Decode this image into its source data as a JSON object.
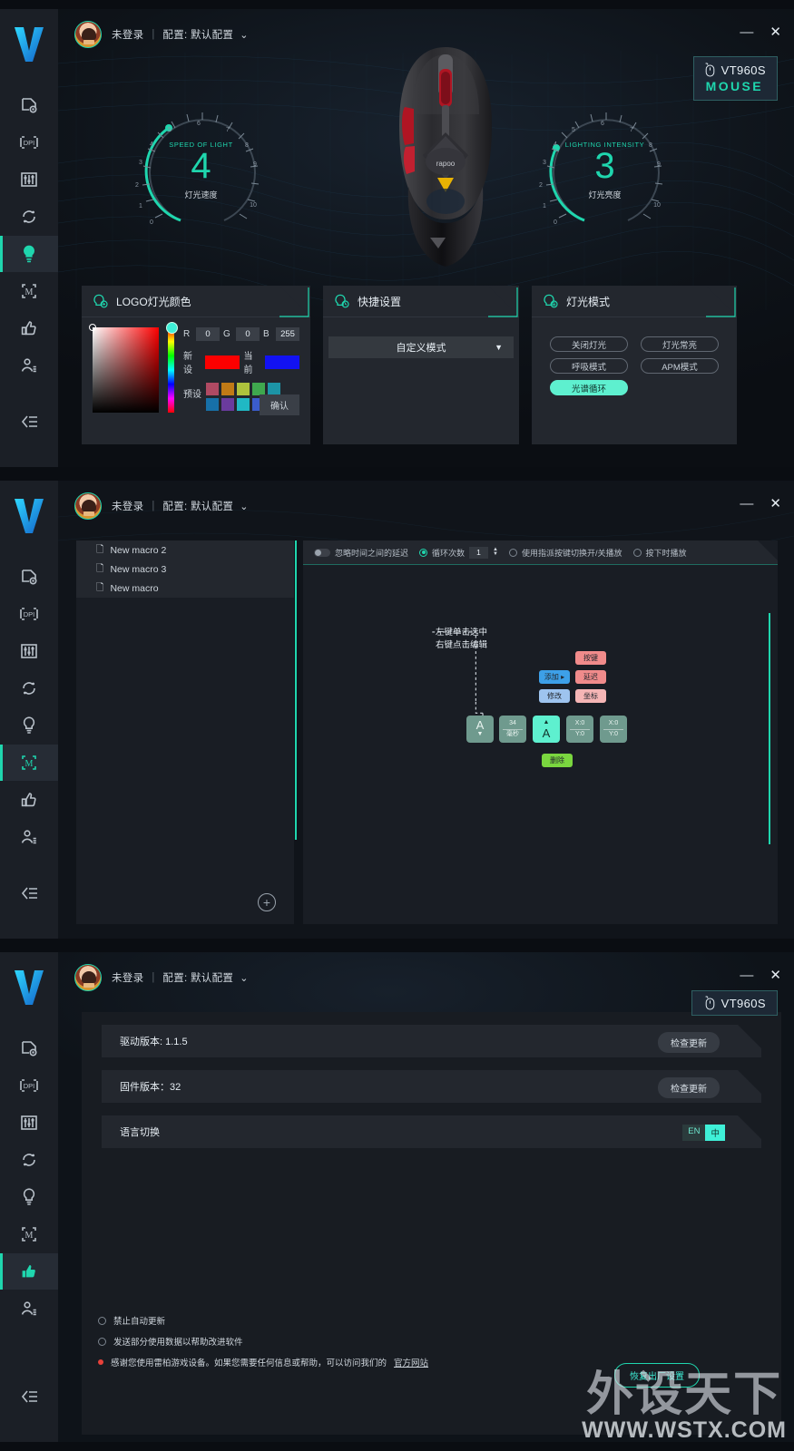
{
  "app": {
    "sidebar": {
      "logo": "rapoo-v-logo",
      "items": [
        {
          "name": "mouse-settings",
          "icon": "mouse-config-icon"
        },
        {
          "name": "dpi",
          "icon": "dpi-icon"
        },
        {
          "name": "performance",
          "icon": "sliders-icon"
        },
        {
          "name": "polling-rate",
          "icon": "refresh-icon"
        },
        {
          "name": "lighting",
          "icon": "lightbulb-icon"
        },
        {
          "name": "macro",
          "icon": "macro-m-icon"
        },
        {
          "name": "support",
          "icon": "thumbs-up-icon"
        },
        {
          "name": "profile",
          "icon": "user-icon"
        },
        {
          "name": "collapse",
          "icon": "collapse-icon"
        }
      ]
    },
    "topbar": {
      "user": "未登录",
      "separator": "|",
      "profile_label": "配置: 默认配置",
      "chevron": "⌄",
      "minimize": "—",
      "close": "✕"
    },
    "device": {
      "name": "VT960S",
      "type": "MOUSE",
      "icon": "mouse-pointer-icon"
    }
  },
  "lighting_window": {
    "dials": [
      {
        "name": "speed-of-light",
        "label": "SPEED OF LIGHT",
        "value": "4",
        "sub": "灯光速度",
        "min": "0",
        "max": "10",
        "ticks": [
          "0",
          "1",
          "2",
          "3",
          "4",
          "5",
          "6",
          "7",
          "8",
          "9",
          "10"
        ]
      },
      {
        "name": "lighting-intensity",
        "label": "LIGHTING INTENSITY",
        "value": "3",
        "sub": "灯光亮度",
        "min": "0",
        "max": "10",
        "ticks": [
          "0",
          "1",
          "2",
          "3",
          "4",
          "5",
          "6",
          "7",
          "8",
          "9",
          "10"
        ]
      }
    ],
    "color_panel": {
      "title": "LOGO灯光颜色",
      "icon": "bulb-color-icon",
      "r_label": "R",
      "r_value": "0",
      "g_label": "G",
      "g_value": "0",
      "b_label": "B",
      "b_value": "255",
      "new_label": "新设",
      "new_color": "#fc0000",
      "current_label": "当前",
      "current_color": "#1212f2",
      "preset_label": "预设",
      "presets": [
        "#b04a63",
        "#c07a16",
        "#aec23c",
        "#3fa84e",
        "#1c94a6",
        "#1770a8",
        "#6a3b9e",
        "#20b8c4",
        "#3b5ccc",
        "#b43cd2"
      ],
      "confirm_label": "确认"
    },
    "quick_panel": {
      "title": "快捷设置",
      "icon": "bulb-quick-icon",
      "selected": "自定义模式",
      "caret": "▼"
    },
    "mode_panel": {
      "title": "灯光模式",
      "icon": "bulb-mode-icon",
      "buttons": [
        {
          "label": "关闭灯光",
          "active": false
        },
        {
          "label": "灯光常亮",
          "active": false
        },
        {
          "label": "呼吸模式",
          "active": false
        },
        {
          "label": "APM模式",
          "active": false
        },
        {
          "label": "光谱循环",
          "active": true
        }
      ]
    }
  },
  "macro_window": {
    "list": [
      {
        "label": "New macro 2",
        "selected": true
      },
      {
        "label": "New macro 3",
        "selected": true
      },
      {
        "label": "New macro",
        "selected": true
      }
    ],
    "add_button": "+",
    "toolbar": {
      "ignore_delay": "忽略时间之间的延迟",
      "loop_count": "循环次数",
      "loop_value": "1",
      "toggle_play": "使用指派按键切换开/关播放",
      "play_on_press": "按下时播放"
    },
    "hint_line1": "左键单击选中",
    "hint_line2": "右键点击编辑",
    "menu": [
      {
        "label": "添加 ▸",
        "color": "#3da0e8",
        "name": "add-menu-item"
      },
      {
        "label": "修改",
        "color": "#9ec4ef",
        "name": "edit-menu-item"
      },
      {
        "label": "按键",
        "color": "#f08b8b",
        "name": "key-menu-item"
      },
      {
        "label": "延迟",
        "color": "#f08b8b",
        "name": "delay-menu-item"
      },
      {
        "label": "坐标",
        "color": "#f5b5b5",
        "name": "coord-menu-item"
      },
      {
        "label": "删除",
        "color": "#7ad63f",
        "name": "delete-menu-item"
      }
    ],
    "tiles": [
      {
        "name": "key-down-tile",
        "big": "A",
        "arrow": "▼",
        "color": "#6f9a8e",
        "selected": false
      },
      {
        "name": "delay-tile",
        "top": "34",
        "bottom": "毫秒",
        "color": "#6f9a8e",
        "selected": false
      },
      {
        "name": "key-up-tile",
        "big": "A",
        "arrow": "▲",
        "color": "#5ef0cf",
        "selected": true
      },
      {
        "name": "coord-tile-1",
        "top": "X:0",
        "bottom": "Y:0",
        "color": "#6f9a8e",
        "selected": false
      },
      {
        "name": "coord-tile-2",
        "top": "X:0",
        "bottom": "Y:0",
        "color": "#6f9a8e",
        "selected": false
      }
    ]
  },
  "settings_window": {
    "rows": [
      {
        "name": "driver-version-row",
        "label": "驱动版本: 1.1.5",
        "button": "检查更新"
      },
      {
        "name": "firmware-version-row",
        "label": "固件版本：32",
        "button": "检查更新"
      },
      {
        "name": "language-row",
        "label": "语言切换",
        "lang_en": "EN",
        "lang_cn": "中"
      }
    ],
    "options": [
      {
        "name": "disable-auto-update",
        "label": "禁止自动更新",
        "checked": false
      },
      {
        "name": "send-usage-data",
        "label": "发送部分使用数据以帮助改进软件",
        "checked": false
      }
    ],
    "notice_prefix": "感谢您使用雷柏游戏设备。如果您需要任何信息或帮助，可以访问我们的",
    "notice_link": "官方网站",
    "reset_button": "恢复出厂设置"
  },
  "watermark": {
    "line1": "外设天下",
    "line2": "WWW.WSTX.COM"
  }
}
